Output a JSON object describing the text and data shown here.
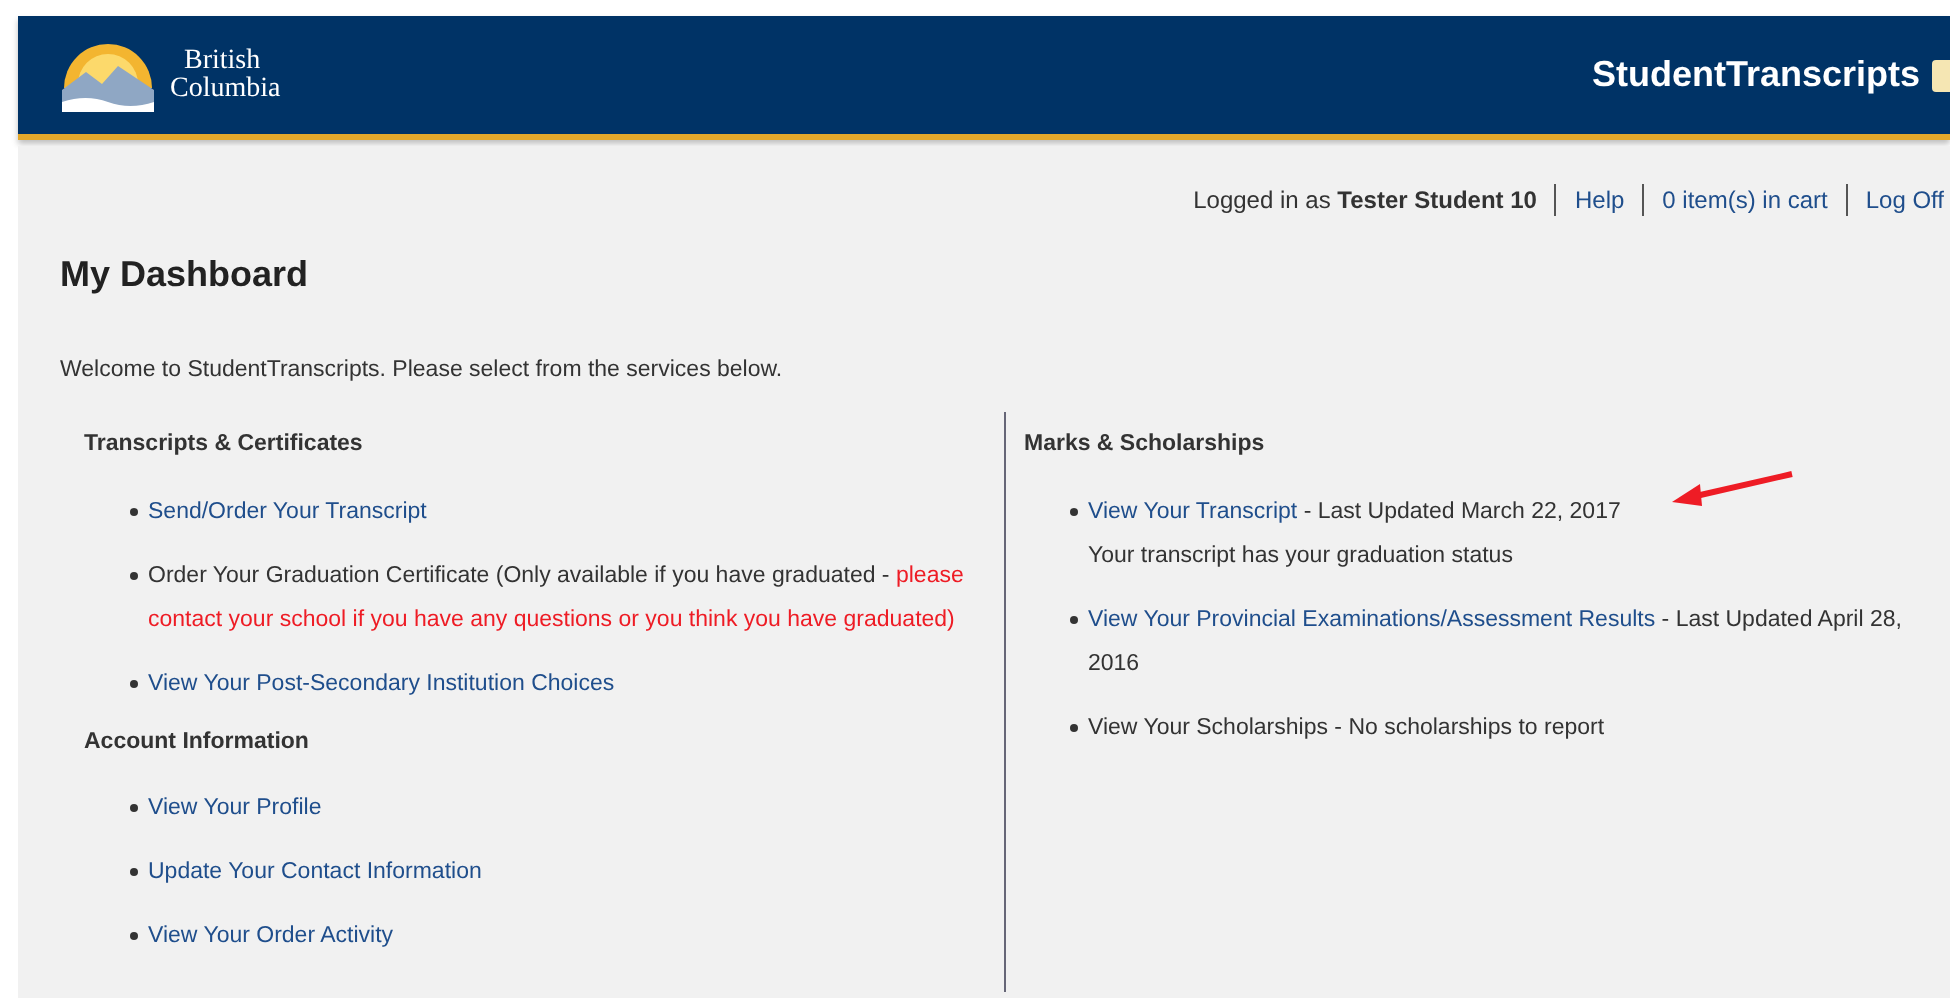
{
  "header": {
    "logo_lines": [
      "British",
      "Columbia"
    ],
    "site_title": "StudentTranscripts"
  },
  "user_bar": {
    "logged_in_label": "Logged in as",
    "user_name": "Tester Student 10",
    "links": [
      "Help",
      "0 item(s) in cart",
      "Log Off"
    ]
  },
  "page_title": "My Dashboard",
  "welcome": "Welcome to StudentTranscripts. Please select from the services below.",
  "columns": [
    {
      "sections": [
        {
          "heading": "Transcripts & Certificates",
          "items": [
            {
              "parts": [
                {
                  "kind": "link",
                  "text": "Send/Order Your Transcript"
                }
              ]
            },
            {
              "parts": [
                {
                  "kind": "text",
                  "text": "Order Your Graduation Certificate (Only available if you have graduated - "
                },
                {
                  "kind": "warning",
                  "text": "please contact your school if you have any questions or you think you have graduated)"
                }
              ]
            },
            {
              "parts": [
                {
                  "kind": "link",
                  "text": "View Your Post-Secondary Institution Choices"
                }
              ]
            }
          ]
        },
        {
          "heading": "Account Information",
          "items": [
            {
              "parts": [
                {
                  "kind": "link",
                  "text": "View Your Profile"
                }
              ]
            },
            {
              "parts": [
                {
                  "kind": "link",
                  "text": "Update Your Contact Information"
                }
              ]
            },
            {
              "parts": [
                {
                  "kind": "link",
                  "text": "View Your Order Activity"
                }
              ]
            }
          ]
        }
      ]
    },
    {
      "sections": [
        {
          "heading": "Marks & Scholarships",
          "items": [
            {
              "parts": [
                {
                  "kind": "link",
                  "text": "View Your Transcript"
                },
                {
                  "kind": "text",
                  "text": " - Last Updated March 22, 2017"
                },
                {
                  "kind": "note",
                  "text": "Your transcript has your graduation status"
                }
              ],
              "annotated": true
            },
            {
              "parts": [
                {
                  "kind": "link",
                  "text": "View Your Provincial Examinations/Assessment Results"
                },
                {
                  "kind": "text",
                  "text": " - Last Updated April 28, 2016"
                }
              ]
            },
            {
              "parts": [
                {
                  "kind": "text",
                  "text": "View Your Scholarships - No scholarships to report"
                }
              ]
            }
          ]
        }
      ]
    }
  ]
}
